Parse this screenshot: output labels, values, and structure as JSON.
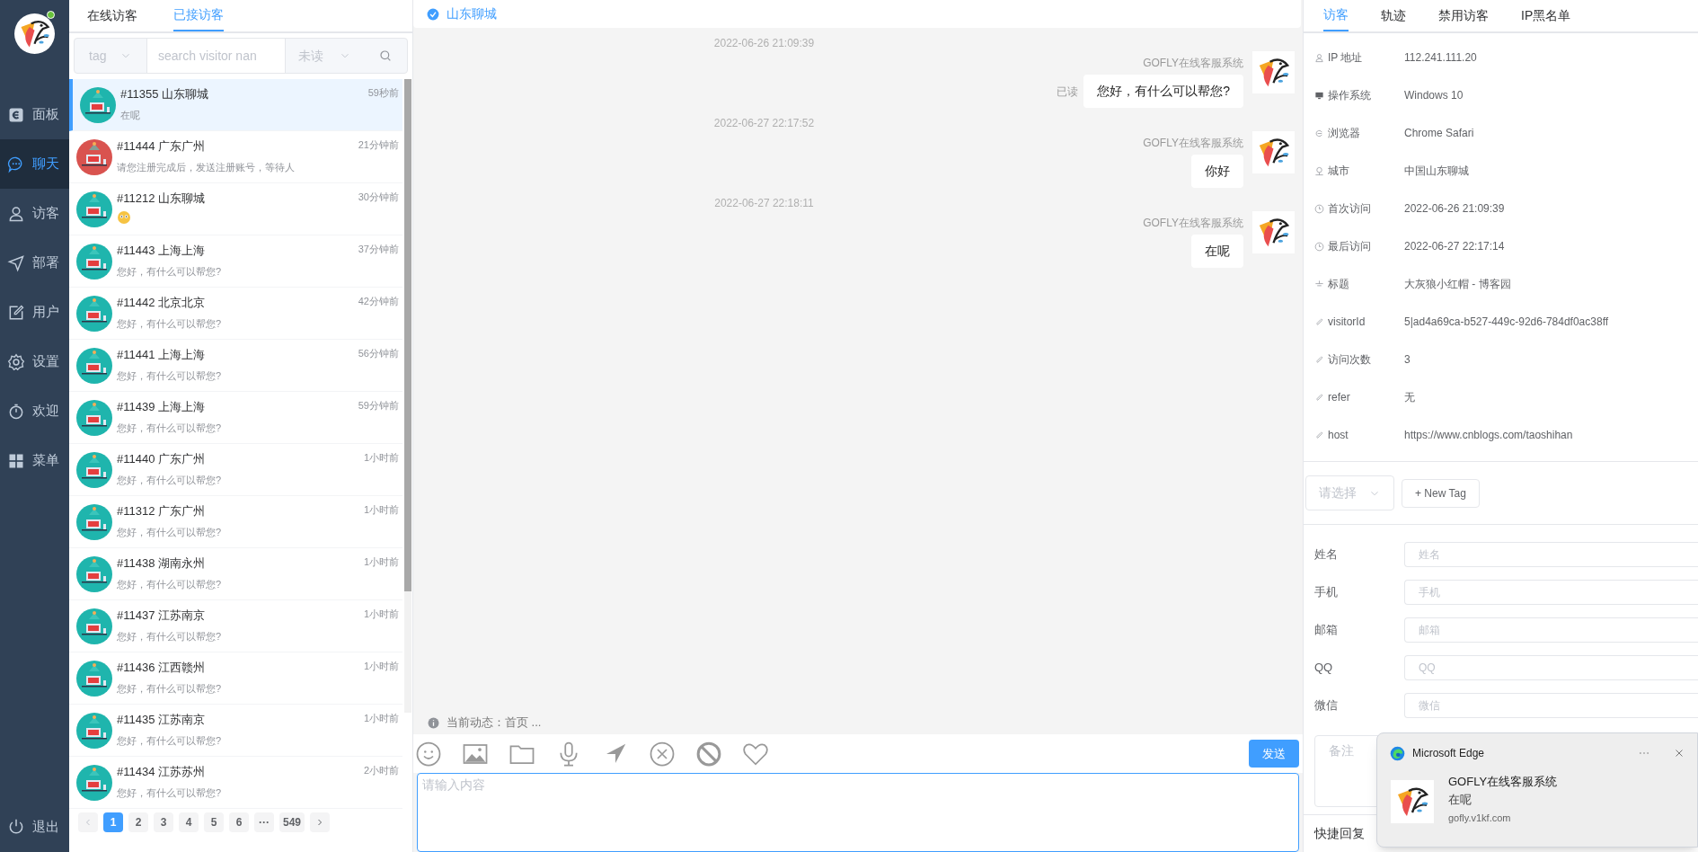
{
  "sidebar": {
    "online": true,
    "items": [
      {
        "label": "面板",
        "selected": false
      },
      {
        "label": "聊天",
        "selected": true
      },
      {
        "label": "访客",
        "selected": false
      },
      {
        "label": "部署",
        "selected": false
      },
      {
        "label": "用户",
        "selected": false
      },
      {
        "label": "设置",
        "selected": false
      },
      {
        "label": "欢迎",
        "selected": false
      },
      {
        "label": "菜单",
        "selected": false
      }
    ],
    "logout": "退出"
  },
  "visitor_panel": {
    "tabs": [
      {
        "label": "在线访客",
        "selected": false
      },
      {
        "label": "已接访客",
        "selected": true
      }
    ],
    "filters": {
      "tag_placeholder": "tag",
      "search_placeholder": "search visitor nan",
      "unread_placeholder": "未读"
    },
    "visitors": [
      {
        "title": "#11355 山东聊城",
        "time": "59秒前",
        "kind": "text",
        "message": "在呢",
        "color": "#1fb5ad",
        "selected": true
      },
      {
        "title": "#11444 广东广州",
        "time": "21分钟前",
        "kind": "text",
        "message": "请您注册完成后，发送注册账号，等待人",
        "color": "#d9534f",
        "selected": false
      },
      {
        "title": "#11212 山东聊城",
        "time": "30分钟前",
        "kind": "sticker",
        "color": "#1fb5ad",
        "selected": false
      },
      {
        "title": "#11443 上海上海",
        "time": "37分钟前",
        "kind": "text",
        "message": "您好，有什么可以帮您?",
        "color": "#1fb5ad",
        "selected": false
      },
      {
        "title": "#11442 北京北京",
        "time": "42分钟前",
        "kind": "text",
        "message": "您好，有什么可以帮您?",
        "color": "#1fb5ad",
        "selected": false
      },
      {
        "title": "#11441 上海上海",
        "time": "56分钟前",
        "kind": "text",
        "message": "您好，有什么可以帮您?",
        "color": "#1fb5ad",
        "selected": false
      },
      {
        "title": "#11439 上海上海",
        "time": "59分钟前",
        "kind": "text",
        "message": "您好，有什么可以帮您?",
        "color": "#1fb5ad",
        "selected": false
      },
      {
        "title": "#11440 广东广州",
        "time": "1小时前",
        "kind": "text",
        "message": "您好，有什么可以帮您?",
        "color": "#1fb5ad",
        "selected": false
      },
      {
        "title": "#11312 广东广州",
        "time": "1小时前",
        "kind": "text",
        "message": "您好，有什么可以帮您?",
        "color": "#1fb5ad",
        "selected": false
      },
      {
        "title": "#11438 湖南永州",
        "time": "1小时前",
        "kind": "text",
        "message": "您好，有什么可以帮您?",
        "color": "#1fb5ad",
        "selected": false
      },
      {
        "title": "#11437 江苏南京",
        "time": "1小时前",
        "kind": "text",
        "message": "您好，有什么可以帮您?",
        "color": "#1fb5ad",
        "selected": false
      },
      {
        "title": "#11436 江西赣州",
        "time": "1小时前",
        "kind": "text",
        "message": "您好，有什么可以帮您?",
        "color": "#1fb5ad",
        "selected": false
      },
      {
        "title": "#11435 江苏南京",
        "time": "1小时前",
        "kind": "text",
        "message": "您好，有什么可以帮您?",
        "color": "#1fb5ad",
        "selected": false
      },
      {
        "title": "#11434 江苏苏州",
        "time": "2小时前",
        "kind": "text",
        "message": "您好，有什么可以帮您?",
        "color": "#1fb5ad",
        "selected": false
      }
    ],
    "pagination": [
      {
        "label": "1",
        "selected": true
      },
      {
        "label": "2",
        "selected": false
      },
      {
        "label": "3",
        "selected": false
      },
      {
        "label": "4",
        "selected": false
      },
      {
        "label": "5",
        "selected": false
      },
      {
        "label": "6",
        "selected": false
      },
      {
        "label": "···",
        "selected": false
      },
      {
        "label": "549",
        "selected": false
      }
    ]
  },
  "chat": {
    "visitor": "山东聊城",
    "messages": [
      {
        "time": "2022-06-26 21:09:39",
        "sender": "GOFLY在线客服系统",
        "text": "您好，有什么可以帮您?",
        "status": "已读"
      },
      {
        "time": "2022-06-27 22:17:52",
        "sender": "GOFLY在线客服系统",
        "text": "你好"
      },
      {
        "time": "2022-06-27 22:18:11",
        "sender": "GOFLY在线客服系统",
        "text": "在呢"
      }
    ],
    "activity": "当前动态：首页 ...",
    "send": "发送",
    "input_placeholder": "请输入内容"
  },
  "detail_panel": {
    "tabs": [
      {
        "label": "访客",
        "selected": true
      },
      {
        "label": "轨迹",
        "selected": false
      },
      {
        "label": "禁用访客",
        "selected": false
      },
      {
        "label": "IP黑名单",
        "selected": false
      }
    ],
    "info": [
      {
        "label": "IP 地址",
        "value": "112.241.111.20"
      },
      {
        "label": "操作系统",
        "value": "Windows 10"
      },
      {
        "label": "浏览器",
        "value": "Chrome Safari"
      },
      {
        "label": "城市",
        "value": "中国山东聊城"
      },
      {
        "label": "首次访问",
        "value": "2022-06-26 21:09:39"
      },
      {
        "label": "最后访问",
        "value": "2022-06-27 22:17:14"
      },
      {
        "label": "标题",
        "value": "大灰狼小红帽 - 博客园"
      },
      {
        "label": "visitorId",
        "value": "5|ad4a69ca-b527-449c-92d6-784df0ac38ff"
      },
      {
        "label": "访问次数",
        "value": "3"
      },
      {
        "label": "refer",
        "value": "无"
      },
      {
        "label": "host",
        "value": "https://www.cnblogs.com/taoshihan"
      }
    ],
    "tag_placeholder": "请选择",
    "new_tag": "+ New Tag",
    "form": [
      {
        "label": "姓名",
        "placeholder": "姓名"
      },
      {
        "label": "手机",
        "placeholder": "手机"
      },
      {
        "label": "邮箱",
        "placeholder": "邮箱"
      },
      {
        "label": "QQ",
        "placeholder": "QQ"
      },
      {
        "label": "微信",
        "placeholder": "微信"
      }
    ],
    "remark_placeholder": "备注",
    "quick_reply": "快捷回复"
  },
  "notification": {
    "app": "Microsoft Edge",
    "title": "GOFLY在线客服系统",
    "body": "在呢",
    "source": "gofly.v1kf.com"
  }
}
